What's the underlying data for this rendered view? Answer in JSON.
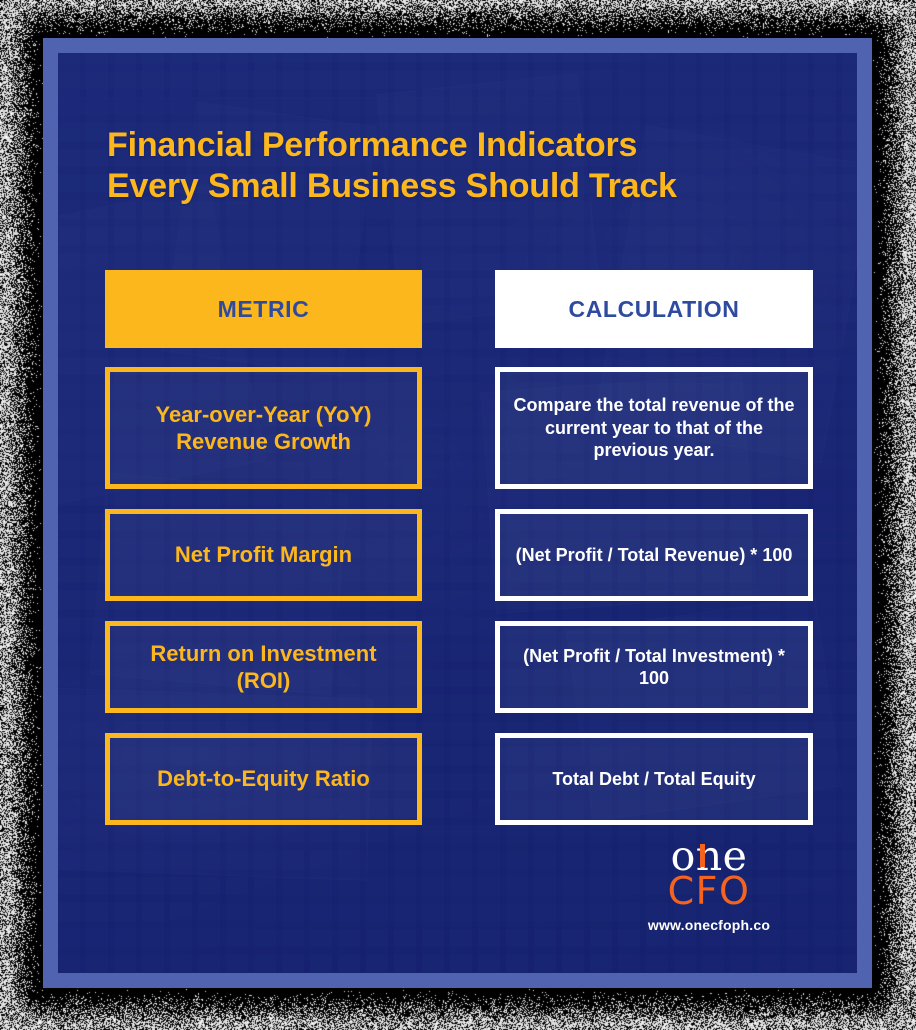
{
  "poster": {
    "title_line1": "Financial Performance Indicators",
    "title_line2": "Every Small Business Should Track"
  },
  "table": {
    "headers": {
      "metric": "METRIC",
      "calculation": "CALCULATION"
    },
    "rows": [
      {
        "metric": "Year-over-Year (YoY) Revenue Growth",
        "calculation": "Compare the total revenue of the current year to that of the previous year."
      },
      {
        "metric": "Net Profit Margin",
        "calculation": "(Net Profit / Total Revenue) * 100"
      },
      {
        "metric": "Return on Investment (ROI)",
        "calculation": "(Net Profit / Total Investment) * 100"
      },
      {
        "metric": "Debt-to-Equity Ratio",
        "calculation": "Total Debt / Total Equity"
      }
    ]
  },
  "logo": {
    "wordmark_part1": "o",
    "wordmark_n": "n",
    "wordmark_part2": "e",
    "wordmark_cfo": "CFO",
    "website": "www.onecfoph.co"
  },
  "colors": {
    "accent_yellow": "#FCB71C",
    "brand_orange": "#F4641E",
    "card_blue": "#3D52A3",
    "band_blue": "#4F63B0",
    "header_text_blue": "#2F4BA0",
    "white": "#FFFFFF"
  }
}
